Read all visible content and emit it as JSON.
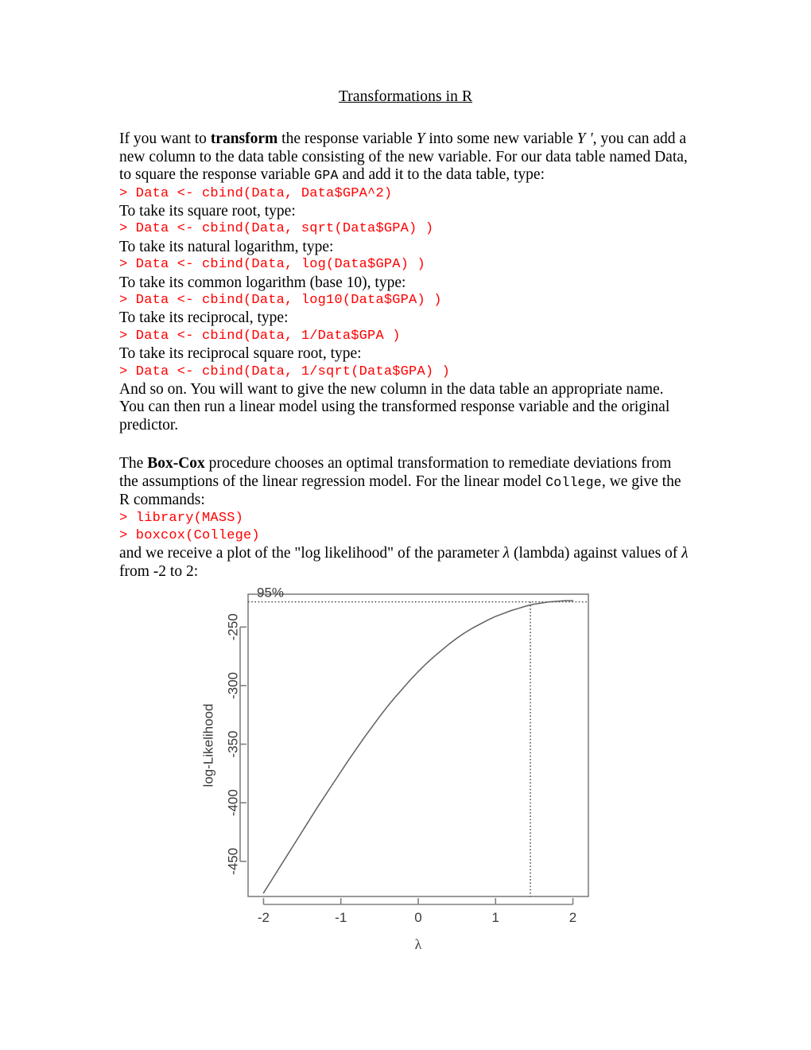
{
  "document": {
    "title": "Transformations in R",
    "paragraph_1": {
      "part_1": "If you want to ",
      "bold_1": "transform",
      "part_2": " the response variable ",
      "var_y": "Y",
      "part_3": " into some new variable ",
      "var_y_prime": "Y '",
      "part_4": ", you can add a new column to the data table consisting of the new variable.  For our data table named Data, to square the response variable ",
      "code_gpa": "GPA",
      "part_5": " and add it to the data table, type:"
    },
    "code_lines": [
      "> Data <- cbind(Data, Data$GPA^2)",
      "> Data <- cbind(Data, sqrt(Data$GPA) )",
      "> Data <- cbind(Data, log(Data$GPA) )",
      "> Data <- cbind(Data, log10(Data$GPA) )",
      "> Data <- cbind(Data, 1/Data$GPA )",
      "> Data <- cbind(Data, 1/sqrt(Data$GPA) )"
    ],
    "intro_lines": [
      "To take its square root, type:",
      "To take its natural logarithm, type:",
      "To take its common logarithm (base 10), type:",
      "To take its reciprocal, type:",
      "To take its reciprocal square root, type:"
    ],
    "paragraph_2": "And so on.  You will want to give the new column in the data table an appropriate name.  You can then run a linear model using the transformed response variable and the original predictor.",
    "paragraph_3": {
      "part_1": "The ",
      "bold_1": "Box-Cox",
      "part_2": " procedure chooses an optimal transformation to remediate deviations from the assumptions of the linear regression model.  For the linear model ",
      "code_college": "College",
      "part_3": ", we give the R commands:"
    },
    "boxcox_code_lines": [
      "> library(MASS)",
      "> boxcox(College)"
    ],
    "paragraph_4": {
      "part_1": "and we receive a plot of the \"log likelihood\" of the parameter ",
      "lambda": "λ",
      "part_2": " (lambda) against values of ",
      "lambda_2": "λ",
      "part_3": " from -2 to 2:"
    }
  },
  "chart_data": {
    "type": "line",
    "title": "",
    "xlabel": "λ",
    "ylabel": "log-Likelihood",
    "xlim": [
      -2.2,
      2.2
    ],
    "ylim": [
      -480,
      -222
    ],
    "xticks": [
      "-2",
      "-1",
      "0",
      "1",
      "2"
    ],
    "xtick_values": [
      -2,
      -1,
      0,
      1,
      2
    ],
    "yticks": [
      "-450",
      "-400",
      "-350",
      "-300",
      "-250"
    ],
    "ytick_values": [
      -450,
      -400,
      -350,
      -300,
      -250
    ],
    "grid": false,
    "legend": null,
    "annotations": [
      {
        "label": "95%",
        "type": "hline",
        "y": -228.5
      },
      {
        "label": "",
        "type": "vline",
        "x": 1.45
      }
    ],
    "x": [
      -2.0,
      -1.9,
      -1.8,
      -1.7,
      -1.6,
      -1.5,
      -1.4,
      -1.3,
      -1.2,
      -1.1,
      -1.0,
      -0.9,
      -0.8,
      -0.7,
      -0.6,
      -0.5,
      -0.4,
      -0.3,
      -0.2,
      -0.1,
      0.0,
      0.1,
      0.2,
      0.3,
      0.4,
      0.5,
      0.6,
      0.7,
      0.8,
      0.9,
      1.0,
      1.1,
      1.2,
      1.3,
      1.4,
      1.5,
      1.6,
      1.7,
      1.8,
      1.9,
      2.0
    ],
    "y": [
      -477.0,
      -466.5,
      -456.0,
      -445.5,
      -435.0,
      -424.5,
      -414.0,
      -403.5,
      -393.5,
      -383.5,
      -373.5,
      -363.5,
      -354.0,
      -344.5,
      -335.5,
      -326.5,
      -318.0,
      -310.0,
      -302.5,
      -295.0,
      -288.0,
      -281.5,
      -275.5,
      -270.0,
      -264.5,
      -259.5,
      -255.0,
      -251.0,
      -247.5,
      -244.0,
      -241.0,
      -238.5,
      -236.0,
      -234.0,
      -232.0,
      -230.5,
      -229.5,
      -228.5,
      -228.0,
      -227.5,
      -227.5
    ],
    "series": [
      {
        "name": "log-Likelihood",
        "values": [
          -477.0,
          -466.5,
          -456.0,
          -445.5,
          -435.0,
          -424.5,
          -414.0,
          -403.5,
          -393.5,
          -383.5,
          -373.5,
          -363.5,
          -354.0,
          -344.5,
          -335.5,
          -326.5,
          -318.0,
          -310.0,
          -302.5,
          -295.0,
          -288.0,
          -281.5,
          -275.5,
          -270.0,
          -264.5,
          -259.5,
          -255.0,
          -251.0,
          -247.5,
          -244.0,
          -241.0,
          -238.5,
          -236.0,
          -234.0,
          -232.0,
          -230.5,
          -229.5,
          -228.5,
          -228.0,
          -227.5,
          -227.5
        ]
      }
    ],
    "ci_label": "95%",
    "mle_lambda": 1.45
  }
}
